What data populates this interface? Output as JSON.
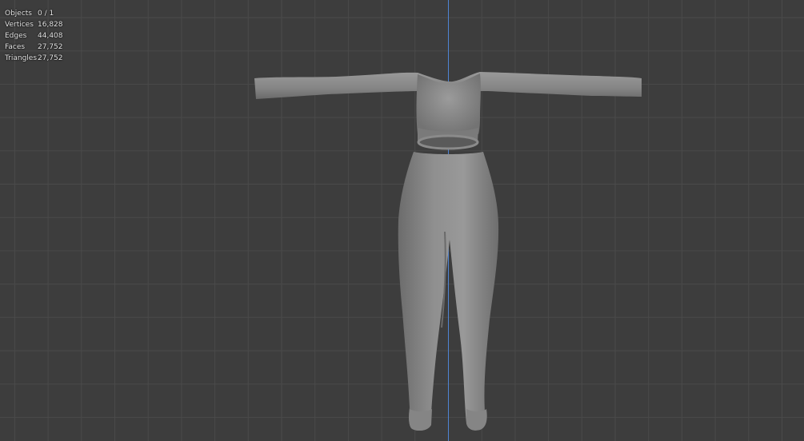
{
  "viewport": {
    "background": "#3d3d3d",
    "grid_color": "#4a4a4a",
    "axis_color": "#4f84d4",
    "mesh_color": "#8c8c8c"
  },
  "stats": {
    "rows": [
      {
        "label": "Objects",
        "value": "0 / 1"
      },
      {
        "label": "Vertices",
        "value": "16,828"
      },
      {
        "label": "Edges",
        "value": "44,408"
      },
      {
        "label": "Faces",
        "value": "27,752"
      },
      {
        "label": "Triangles",
        "value": "27,752"
      }
    ]
  },
  "model": {
    "icon": "outfit-mesh"
  }
}
